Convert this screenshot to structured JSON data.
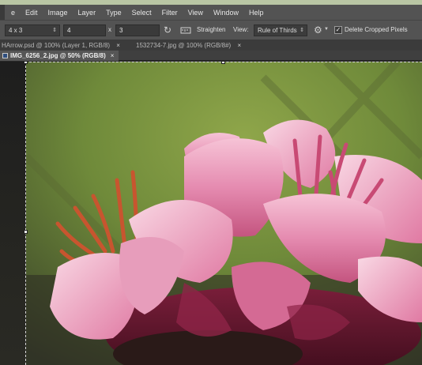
{
  "menu": {
    "items": [
      "e",
      "Edit",
      "Image",
      "Layer",
      "Type",
      "Select",
      "Filter",
      "View",
      "Window",
      "Help"
    ]
  },
  "options": {
    "ratio_preset": "4 x 3",
    "width_value": "4",
    "times_symbol": "x",
    "height_value": "3",
    "straighten_label": "Straighten",
    "view_label": "View:",
    "view_value": "Rule of Thirds",
    "delete_cropped_label": "Delete Cropped Pixels",
    "delete_cropped_checked": true
  },
  "tabs": {
    "background": [
      {
        "label": "HArrow.psd @ 100% (Layer 1, RGB/8)",
        "close": "×"
      },
      {
        "label": "1532734-7.jpg @ 100% (RGB/8#)",
        "close": "×"
      }
    ],
    "active": {
      "label": "IMG_6256_2.jpg @ 50% (RGB/8)",
      "close": "×"
    }
  },
  "colors": {
    "accent_strip": "#b9c6a4",
    "menubar": "#535353",
    "flower_pink": "#e58bb0",
    "background_green": "#6f8a3a"
  }
}
